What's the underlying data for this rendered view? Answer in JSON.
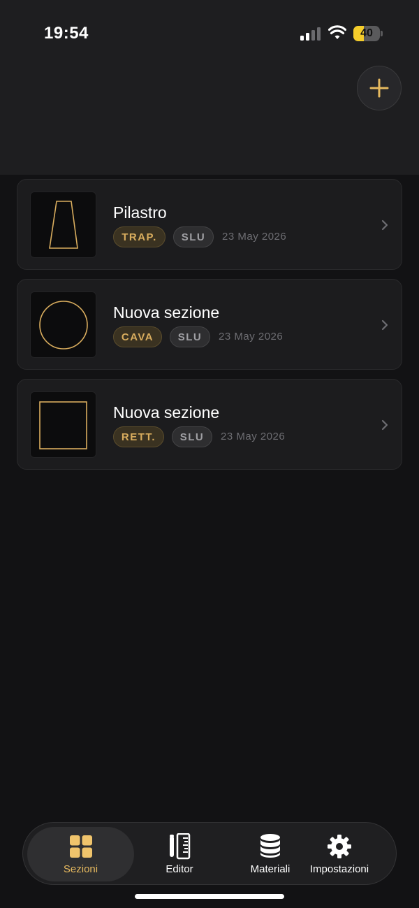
{
  "status_bar": {
    "time": "19:54",
    "battery": "40",
    "battery_level_percent": 40
  },
  "header": {
    "add_icon": "plus-icon"
  },
  "sections": [
    {
      "title": "Pilastro",
      "type_badge": "TRAP.",
      "state_badge": "SLU",
      "date": "23 May 2026",
      "shape_icon": "trapezoid-shape-icon"
    },
    {
      "title": "Nuova sezione",
      "type_badge": "CAVA",
      "state_badge": "SLU",
      "date": "23 May 2026",
      "shape_icon": "circle-shape-icon"
    },
    {
      "title": "Nuova sezione",
      "type_badge": "RETT.",
      "state_badge": "SLU",
      "date": "23 May 2026",
      "shape_icon": "rectangle-shape-icon"
    }
  ],
  "tabs": [
    {
      "label": "Sezioni",
      "icon": "grid-icon",
      "active": true
    },
    {
      "label": "Editor",
      "icon": "ruler-pencil-icon",
      "active": false
    },
    {
      "label": "Materiali",
      "icon": "database-icon",
      "active": false
    },
    {
      "label": "Impostazioni",
      "icon": "gear-icon",
      "active": false
    }
  ],
  "colors": {
    "accent": "#e6b95f",
    "background": "#121214",
    "card": "#1c1c1e"
  }
}
